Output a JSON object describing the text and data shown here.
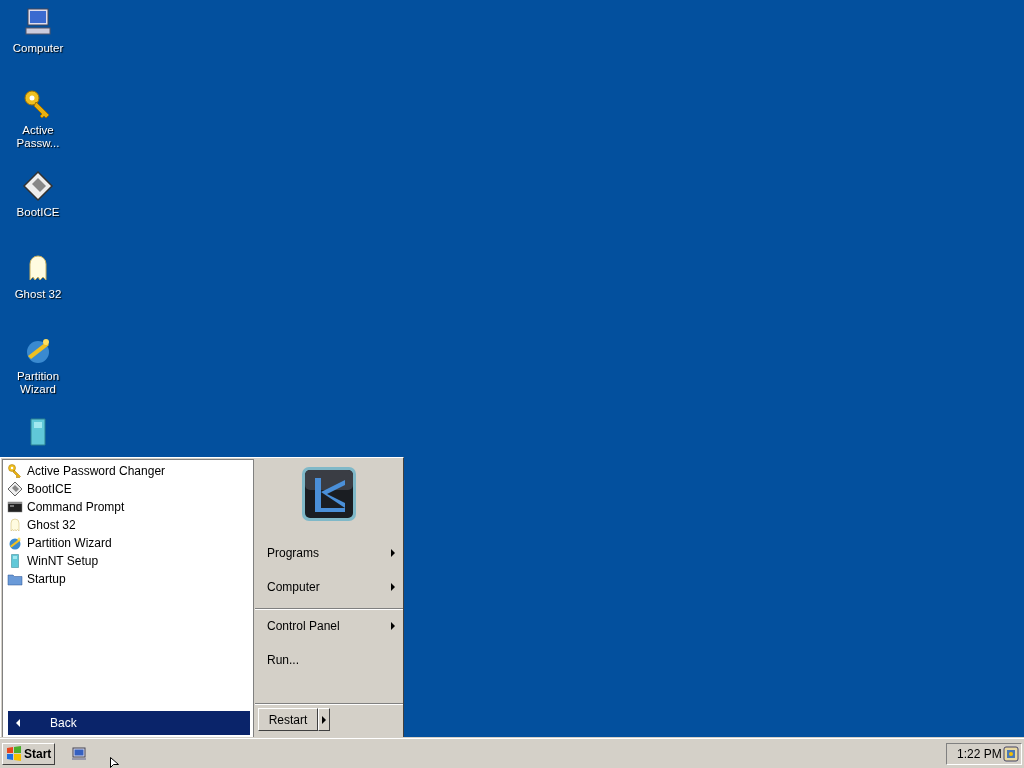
{
  "desktop_icons": [
    {
      "label": "Computer",
      "kind": "computer"
    },
    {
      "label": "Active\nPassw...",
      "kind": "key"
    },
    {
      "label": "BootICE",
      "kind": "disk"
    },
    {
      "label": "Ghost 32",
      "kind": "ghost"
    },
    {
      "label": "Partition\nWizard",
      "kind": "wizard"
    },
    {
      "kind": "setup"
    }
  ],
  "start_menu": {
    "programs": [
      {
        "label": "Active Password Changer",
        "kind": "key"
      },
      {
        "label": "BootICE",
        "kind": "disk"
      },
      {
        "label": "Command Prompt",
        "kind": "console"
      },
      {
        "label": "Ghost 32",
        "kind": "ghost"
      },
      {
        "label": "Partition Wizard",
        "kind": "wizard"
      },
      {
        "label": "WinNT Setup",
        "kind": "setup"
      },
      {
        "label": "Startup",
        "kind": "folder"
      }
    ],
    "back": {
      "label": "Back",
      "selected": true
    },
    "right_items": [
      {
        "label": "Programs",
        "submenu": true,
        "separator_before": false
      },
      {
        "label": "Computer",
        "submenu": true,
        "separator_before": false
      },
      {
        "label": "Control Panel",
        "submenu": true,
        "separator_before": true
      },
      {
        "label": "Run...",
        "submenu": false,
        "separator_before": false
      }
    ],
    "restart": {
      "label": "Restart"
    }
  },
  "taskbar": {
    "start": "Start",
    "clock": "1:22 PM"
  }
}
